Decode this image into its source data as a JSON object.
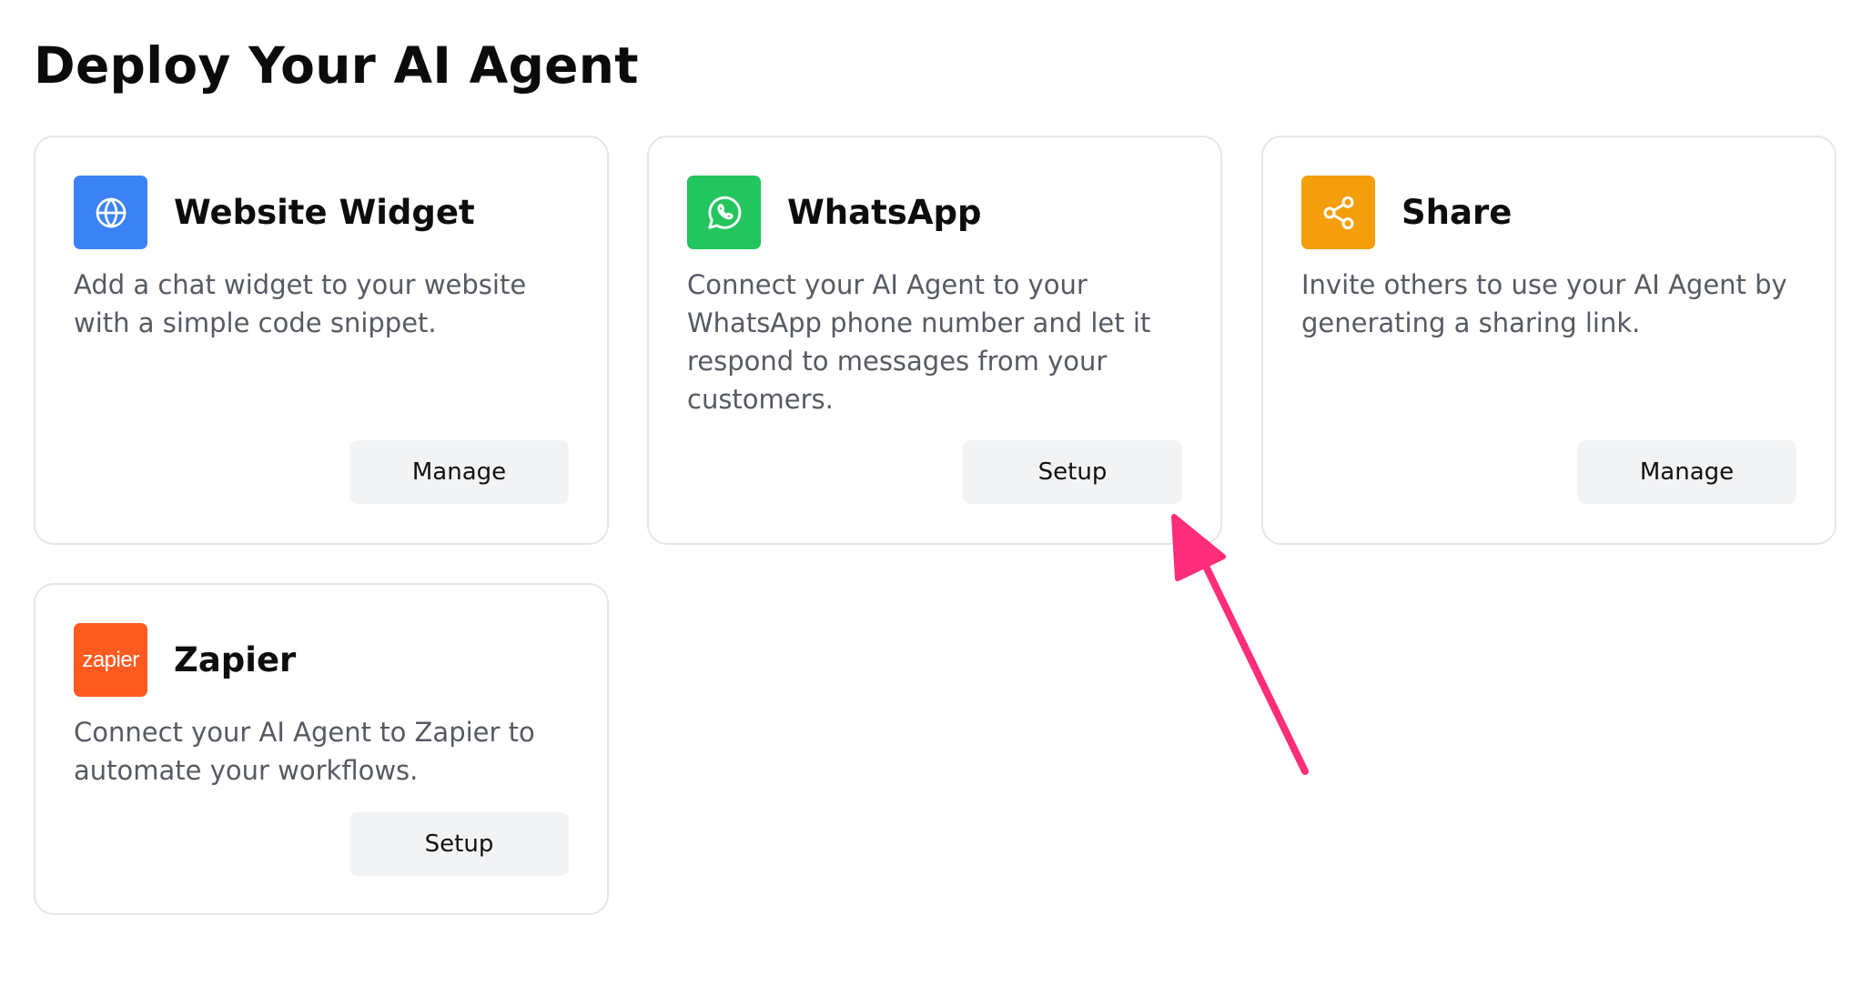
{
  "page": {
    "title": "Deploy Your AI Agent"
  },
  "colors": {
    "website_icon_bg": "#3b82f6",
    "whatsapp_icon_bg": "#22c55e",
    "share_icon_bg": "#f59e0b",
    "zapier_icon_bg": "#ff5a1f",
    "arrow": "#ff2d7a",
    "button_bg": "#f2f3f5"
  },
  "cards": [
    {
      "icon": "globe-icon",
      "title": "Website Widget",
      "description": "Add a chat widget to your website with a simple code snippet.",
      "button_label": "Manage"
    },
    {
      "icon": "whatsapp-icon",
      "title": "WhatsApp",
      "description": "Connect your AI Agent to your WhatsApp phone number and let it respond to messages from your customers.",
      "button_label": "Setup"
    },
    {
      "icon": "share-icon",
      "title": "Share",
      "description": "Invite others to use your AI Agent by generating a sharing link.",
      "button_label": "Manage"
    },
    {
      "icon": "zapier-logo-icon",
      "logo_text": "zapier",
      "title": "Zapier",
      "description": "Connect your AI Agent to Zapier to automate your workflows.",
      "button_label": "Setup"
    }
  ],
  "annotation": {
    "icon": "arrow-annotation-icon",
    "points_to": "WhatsApp Setup button"
  }
}
